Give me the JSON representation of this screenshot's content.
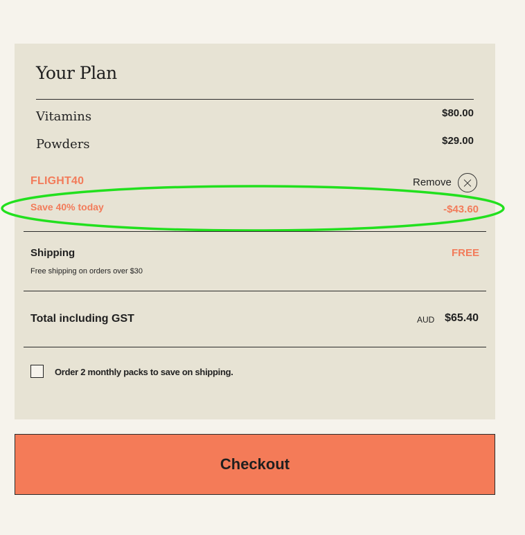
{
  "plan": {
    "title": "Your Plan",
    "items": [
      {
        "label": "Vitamins",
        "price": "$80.00"
      },
      {
        "label": "Powders",
        "price": "$29.00"
      }
    ]
  },
  "promo": {
    "code": "FLIGHT40",
    "remove_label": "Remove",
    "save_text": "Save 40% today",
    "discount": "-$43.60"
  },
  "shipping": {
    "label": "Shipping",
    "note": "Free shipping on orders over $30",
    "value": "FREE"
  },
  "total": {
    "label": "Total including GST",
    "currency": "AUD",
    "value": "$65.40"
  },
  "option": {
    "checked": false,
    "label": "Order 2 monthly packs to save on shipping."
  },
  "checkout": {
    "label": "Checkout"
  },
  "colors": {
    "page_background": "#f6f3ec",
    "panel_background": "#e7e3d4",
    "accent": "#f27b5a",
    "checkout_button": "#f47b58",
    "highlight_ellipse": "#22e01e"
  },
  "icons": {
    "remove": "close-circle-icon"
  }
}
